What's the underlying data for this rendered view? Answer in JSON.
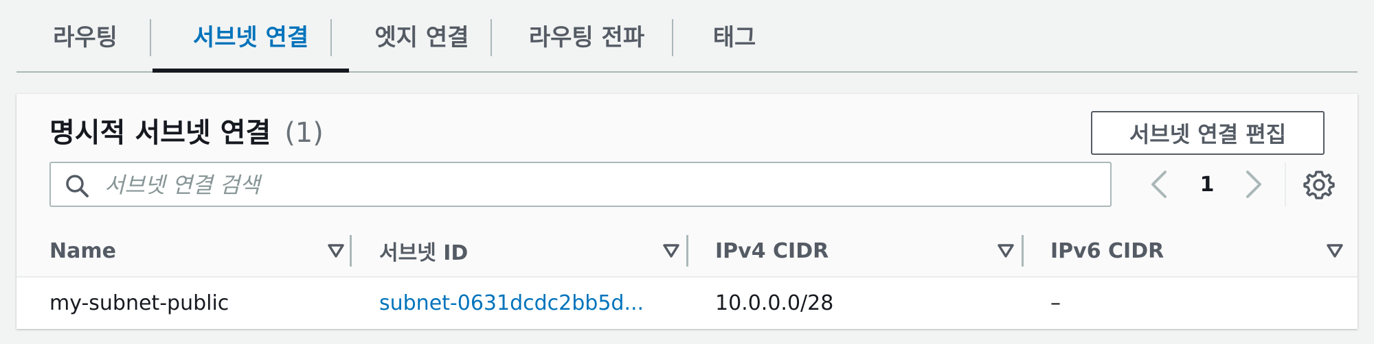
{
  "tabs": [
    {
      "label": "라우팅"
    },
    {
      "label": "서브넷 연결"
    },
    {
      "label": "엣지 연결"
    },
    {
      "label": "라우팅 전파"
    },
    {
      "label": "태그"
    }
  ],
  "active_tab_index": 1,
  "panel": {
    "title": "명시적 서브넷 연결",
    "count": "(1)",
    "edit_button_label": "서브넷 연결 편집"
  },
  "search": {
    "placeholder": "서브넷 연결 검색",
    "value": "",
    "icon": "search-icon"
  },
  "pagination": {
    "current_page": "1",
    "prev_icon": "chevron-left-icon",
    "next_icon": "chevron-right-icon",
    "settings_icon": "gear-icon"
  },
  "table": {
    "columns": [
      "Name",
      "서브넷 ID",
      "IPv4 CIDR",
      "IPv6 CIDR"
    ],
    "rows": [
      {
        "name": "my-subnet-public",
        "subnet_id": "subnet-0631dcdc2bb5d...",
        "ipv4_cidr": "10.0.0.0/28",
        "ipv6_cidr": "–"
      }
    ]
  },
  "colors": {
    "accent": "#0073bb",
    "text": "#16191f",
    "muted": "#545b64"
  }
}
